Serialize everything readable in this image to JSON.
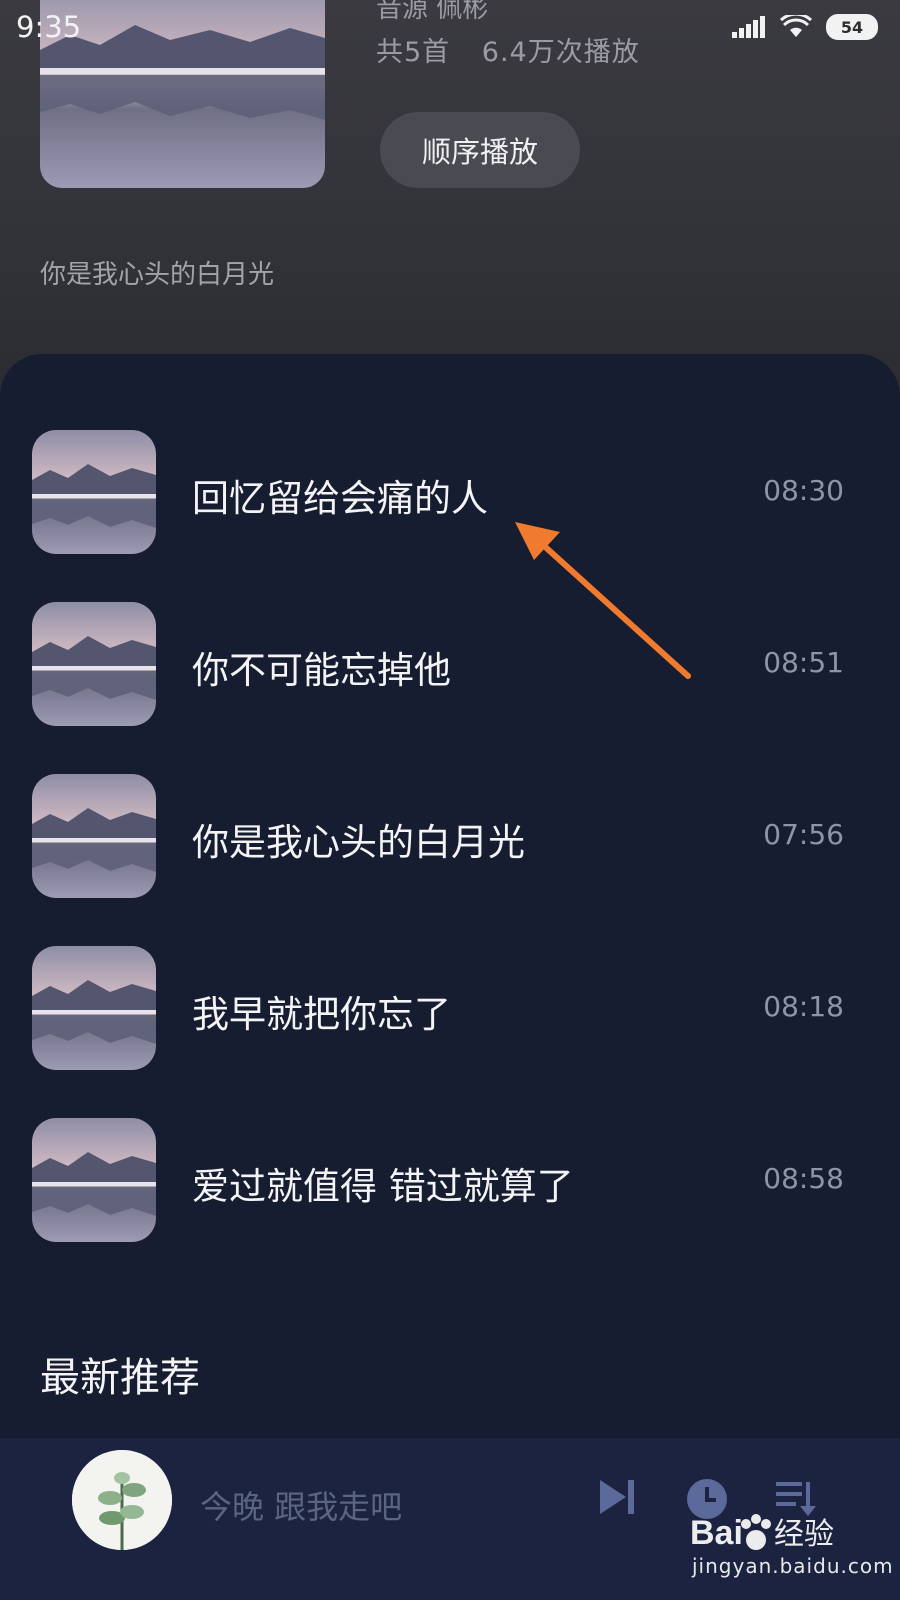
{
  "status_bar": {
    "time": "9:35",
    "battery": "54"
  },
  "album": {
    "source_line": "音源  佩彬",
    "count": "共5首",
    "plays": "6.4万次播放",
    "play_button": "顺序播放",
    "description": "你是我心头的白月光"
  },
  "songs": [
    {
      "title": "回忆留给会痛的人",
      "duration": "08:30"
    },
    {
      "title": "你不可能忘掉他",
      "duration": "08:51"
    },
    {
      "title": "你是我心头的白月光",
      "duration": "07:56"
    },
    {
      "title": "我早就把你忘了",
      "duration": "08:18"
    },
    {
      "title": "爱过就值得 错过就算了",
      "duration": "08:58"
    }
  ],
  "section": {
    "title": "最新推荐"
  },
  "player": {
    "now_playing": "今晚 跟我走吧"
  },
  "watermark": {
    "brand": "Baidu经验",
    "url": "jingyan.baidu.com"
  },
  "colors": {
    "panel": "#161d30",
    "player": "#1b2340",
    "annotation_arrow": "#f07a2e"
  },
  "icons": [
    "signal-icon",
    "wifi-icon",
    "battery-icon",
    "next-track-icon",
    "timer-icon",
    "playlist-icon"
  ]
}
